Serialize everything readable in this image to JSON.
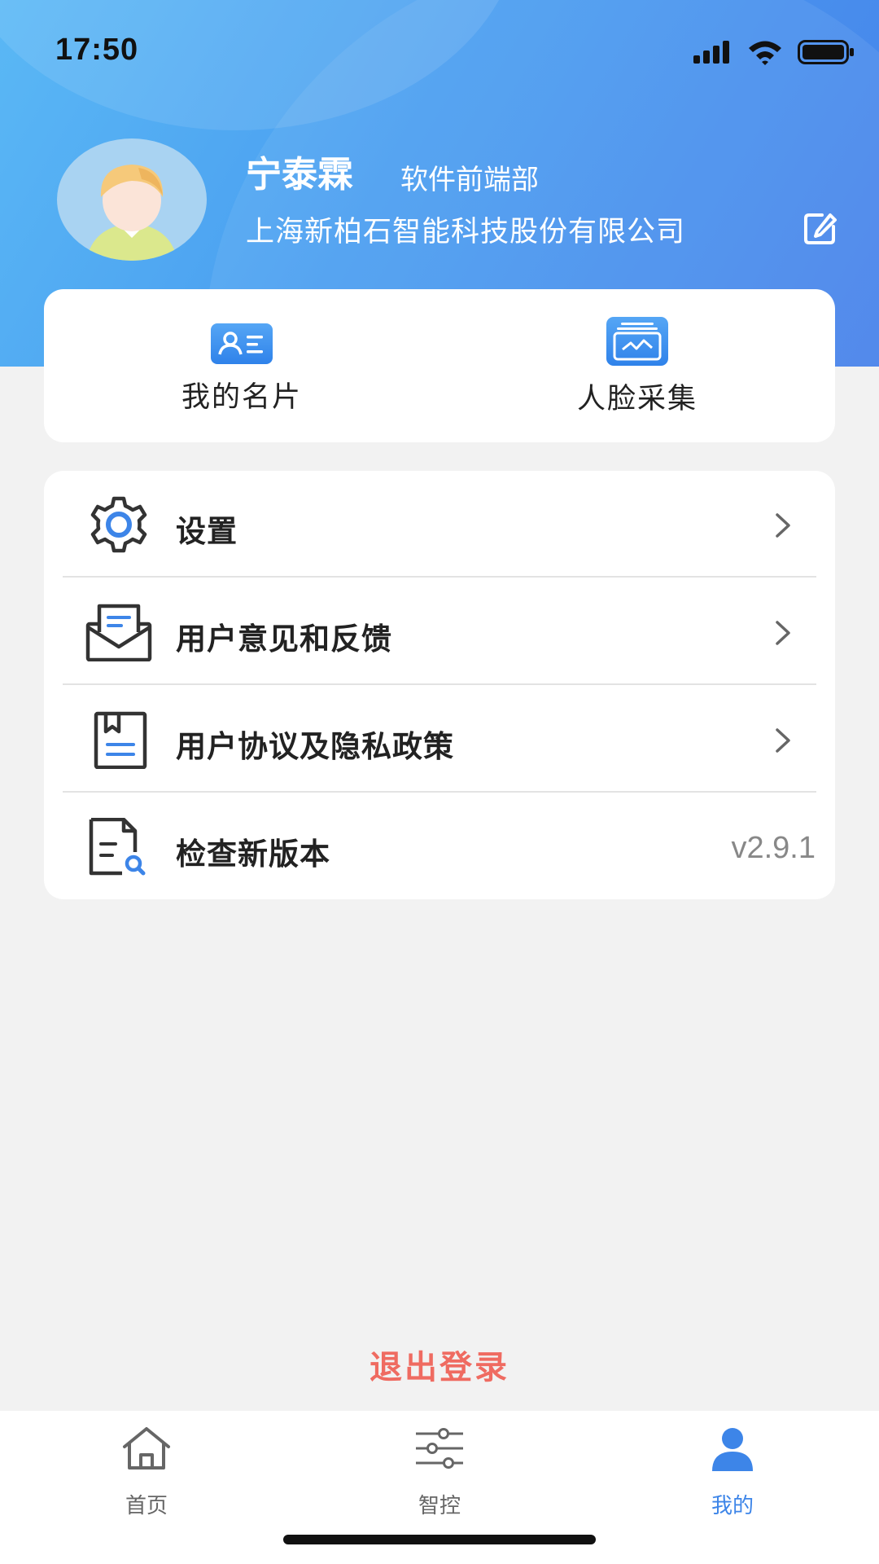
{
  "status_bar": {
    "time": "17:50",
    "icons": [
      "signal-icon",
      "wifi-icon",
      "battery-icon"
    ]
  },
  "profile": {
    "name": "宁泰霖",
    "department": "软件前端部",
    "company": "上海新柏石智能科技股份有限公司",
    "edit_icon": "edit-icon"
  },
  "quick_actions": [
    {
      "label": "我的名片",
      "icon": "business-card-icon"
    },
    {
      "label": "人脸采集",
      "icon": "face-capture-icon"
    }
  ],
  "menu": [
    {
      "label": "设置",
      "icon": "gear-icon",
      "trailing": "chevron"
    },
    {
      "label": "用户意见和反馈",
      "icon": "feedback-mail-icon",
      "trailing": "chevron"
    },
    {
      "label": "用户协议及隐私政策",
      "icon": "agreement-book-icon",
      "trailing": "chevron"
    },
    {
      "label": "检查新版本",
      "icon": "document-search-icon",
      "value": "v2.9.1"
    }
  ],
  "logout_label": "退出登录",
  "tabbar": {
    "active": "我的",
    "items": [
      {
        "label": "首页",
        "icon": "home-icon"
      },
      {
        "label": "智控",
        "icon": "sliders-icon"
      },
      {
        "label": "我的",
        "icon": "user-icon"
      }
    ]
  },
  "colors": {
    "header_gradient_start": "#5ab8f5",
    "header_gradient_end": "#4681ea",
    "accent": "#3d85e8",
    "logout": "#ef6b61",
    "background": "#f2f2f2"
  }
}
